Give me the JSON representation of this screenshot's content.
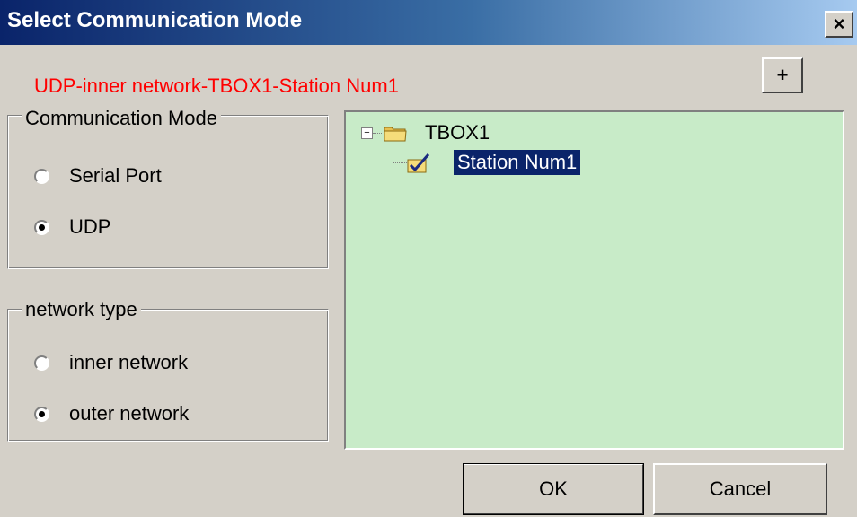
{
  "window": {
    "title": "Select Communication Mode",
    "close_label": "×"
  },
  "status": {
    "text": "UDP-inner network-TBOX1-Station Num1",
    "color": "#ff0000"
  },
  "toolbar": {
    "add_label": "+"
  },
  "communication_mode": {
    "legend": "Communication Mode",
    "options": [
      {
        "label": "Serial Port",
        "checked": false
      },
      {
        "label": "UDP",
        "checked": true
      }
    ]
  },
  "network_type": {
    "legend": "network type",
    "options": [
      {
        "label": "inner network",
        "checked": false
      },
      {
        "label": "outer network",
        "checked": true
      }
    ]
  },
  "tree": {
    "background": "#c8ebc8",
    "root": {
      "label": "TBOX1",
      "expanded": true,
      "icon": "folder-icon",
      "children": [
        {
          "label": "Station Num1",
          "selected": true,
          "icon": "station-checked-icon"
        }
      ]
    }
  },
  "buttons": {
    "ok": "OK",
    "cancel": "Cancel"
  }
}
